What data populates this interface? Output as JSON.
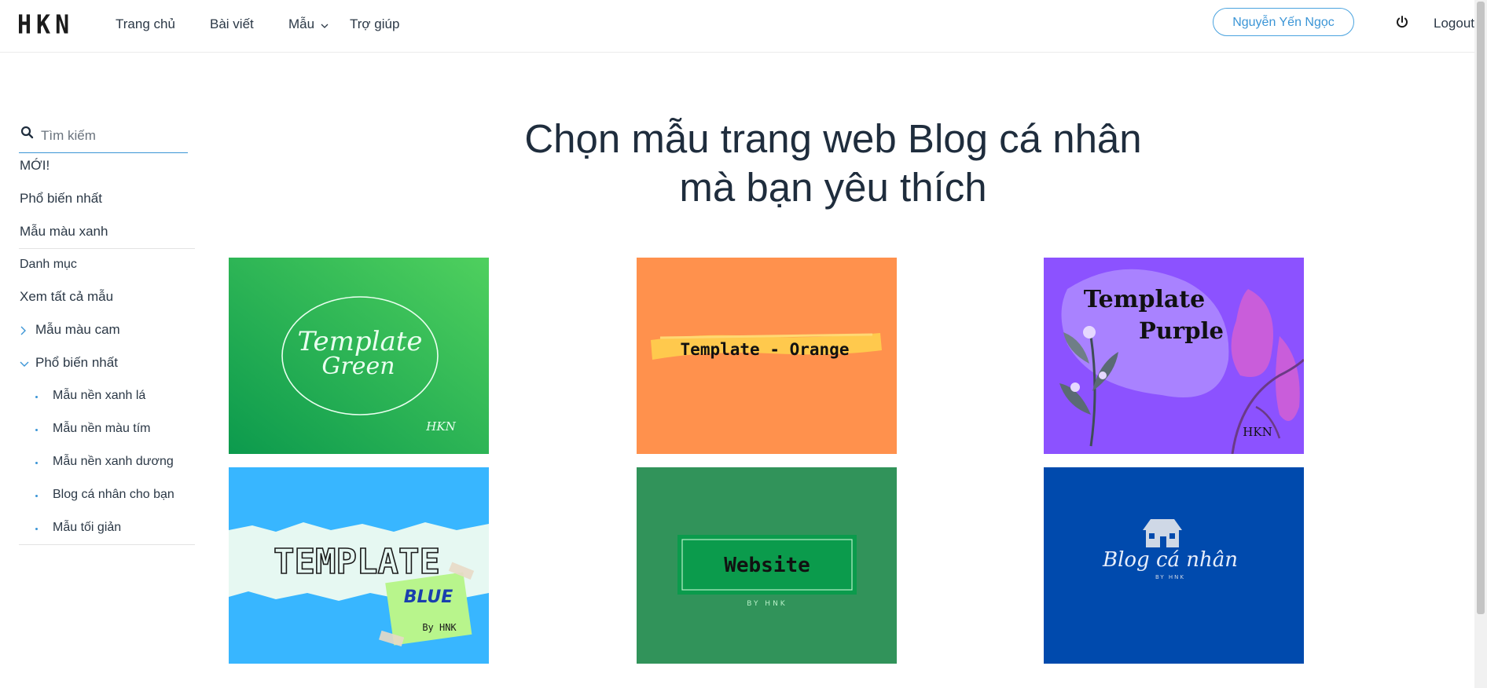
{
  "header": {
    "logo": "HKN",
    "nav": {
      "home": "Trang chủ",
      "posts": "Bài viết",
      "templates": "Mẫu",
      "help": "Trợ giúp"
    },
    "user": "Nguyễn Yến Ngọc",
    "logout": "Logout"
  },
  "sidebar": {
    "search_placeholder": "Tìm kiếm",
    "links": {
      "new": "MỚI!",
      "popular": "Phổ biến nhất",
      "green": "Mẫu màu xanh",
      "categories": "Danh mục",
      "all": "Xem tất cả mẫu",
      "orange": "Mẫu màu cam",
      "popular2": "Phổ biến nhất"
    },
    "subitems": [
      "Mẫu nền xanh lá",
      "Mẫu nền màu tím",
      "Mẫu nền xanh dương",
      "Blog cá nhân cho bạn",
      "Mẫu tối giản"
    ]
  },
  "main": {
    "title_line1": "Chọn mẫu trang web Blog cá nhân",
    "title_line2": "mà bạn yêu thích"
  },
  "templates": {
    "green": {
      "line1": "Template",
      "line2": "Green",
      "brand": "HKN"
    },
    "orange": {
      "label": "Template - Orange"
    },
    "purple": {
      "line1": "Template",
      "line2": "Purple",
      "brand": "HKN"
    },
    "blue": {
      "line1": "TEMPLATE",
      "line2": "BLUE",
      "by": "By HNK"
    },
    "website": {
      "label": "Website",
      "by": "BY HNK"
    },
    "blog": {
      "label": "Blog cá nhân",
      "by": "BY HNK"
    }
  },
  "colors": {
    "accent": "#3b95d6",
    "text_dark": "#1f2d3d",
    "green": "#21a957",
    "orange": "#ff914d",
    "purple": "#8c52ff",
    "sky": "#38b6ff",
    "website_green": "#31935a",
    "blog_blue": "#004aad"
  }
}
